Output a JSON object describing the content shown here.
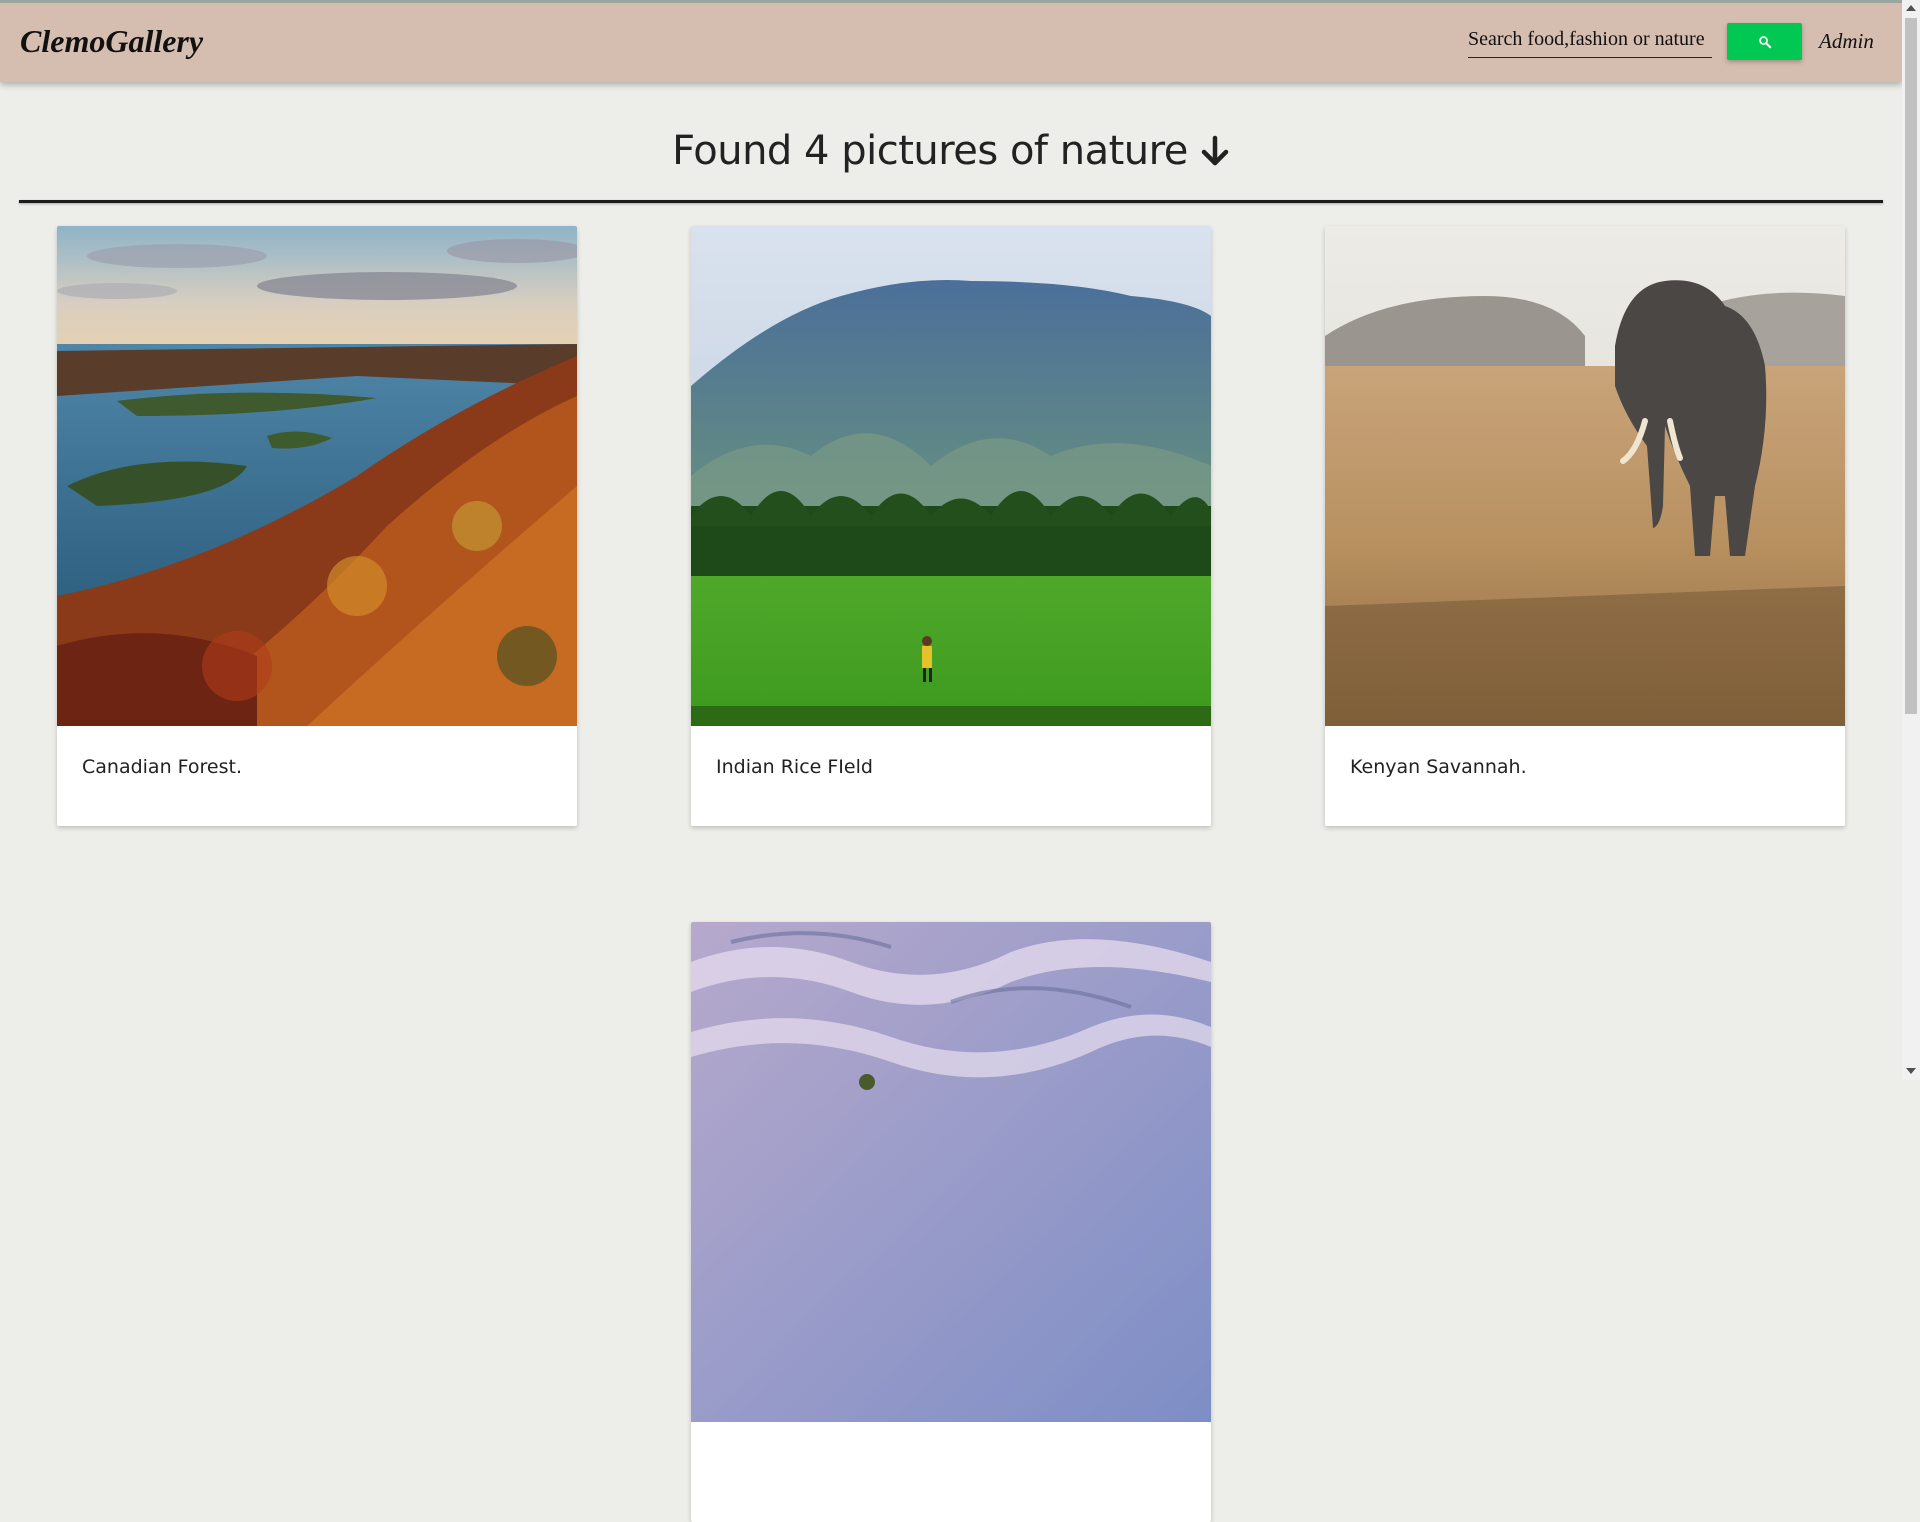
{
  "navbar": {
    "brand": "ClemoGallery",
    "search_placeholder": "Search food,fashion or nature",
    "search_icon": "search-icon",
    "admin_label": "Admin"
  },
  "results": {
    "heading": "Found 4 pictures of nature",
    "heading_icon": "arrow-down-icon"
  },
  "cards": [
    {
      "caption": "Canadian Forest."
    },
    {
      "caption": "Indian Rice FIeld"
    },
    {
      "caption": "Kenyan Savannah."
    },
    {
      "caption": ""
    }
  ],
  "colors": {
    "navbar_bg": "#d5bdaf",
    "page_bg": "#edede9",
    "search_button": "#00c853"
  }
}
